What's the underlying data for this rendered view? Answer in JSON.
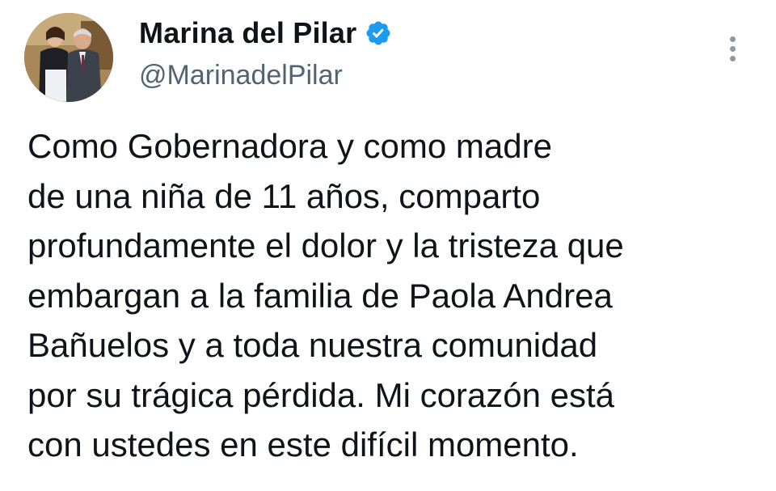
{
  "tweet": {
    "author": {
      "display_name": "Marina del Pilar",
      "handle": "@MarinadelPilar",
      "verified": true,
      "verified_color": "#1d9bf0"
    },
    "more_icon": "more-vertical-icon",
    "text_lines": [
      "Como Gobernadora y como madre",
      "de una niña de 11 años, comparto",
      "profundamente el dolor y la tristeza que",
      "embargan a la familia de Paola Andrea",
      "Bañuelos y a toda nuestra comunidad",
      "por su trágica pérdida. Mi corazón está",
      "con ustedes en este difícil momento."
    ]
  }
}
